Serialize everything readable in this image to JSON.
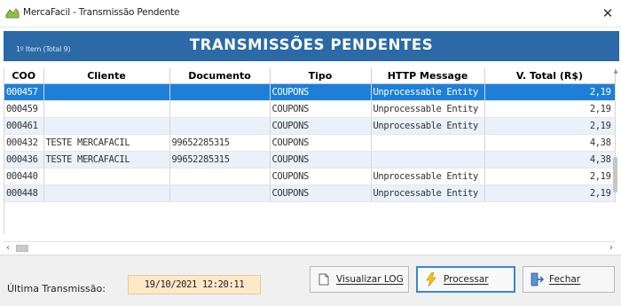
{
  "window": {
    "title": "MercaFacil - Transmissão Pendente",
    "close_glyph": "✕",
    "icon": "app-icon"
  },
  "banner": {
    "item_counter": "1º Item (Total 9)",
    "title": "TRANSMISSÕES PENDENTES",
    "background": "#2b6aa6"
  },
  "grid": {
    "columns": [
      "COO",
      "Cliente",
      "Documento",
      "Tipo",
      "HTTP Message",
      "V. Total (R$)"
    ],
    "rows": [
      {
        "coo": "000457",
        "cliente": "",
        "documento": "",
        "tipo": "COUPONS",
        "http": "Unprocessable Entity",
        "total": "2,19",
        "state": "selected"
      },
      {
        "coo": "000459",
        "cliente": "",
        "documento": "",
        "tipo": "COUPONS",
        "http": "Unprocessable Entity",
        "total": "2,19",
        "state": "normal"
      },
      {
        "coo": "000461",
        "cliente": "",
        "documento": "",
        "tipo": "COUPONS",
        "http": "Unprocessable Entity",
        "total": "2,19",
        "state": "alt"
      },
      {
        "coo": "000432",
        "cliente": "TESTE MERCAFACIL",
        "documento": "99652285315",
        "tipo": "COUPONS",
        "http": "",
        "total": "4,38",
        "state": "normal"
      },
      {
        "coo": "000436",
        "cliente": "TESTE MERCAFACIL",
        "documento": "99652285315",
        "tipo": "COUPONS",
        "http": "",
        "total": "4,38",
        "state": "alt"
      },
      {
        "coo": "000440",
        "cliente": "",
        "documento": "",
        "tipo": "COUPONS",
        "http": "Unprocessable Entity",
        "total": "2,19",
        "state": "normal"
      },
      {
        "coo": "000448",
        "cliente": "",
        "documento": "",
        "tipo": "COUPONS",
        "http": "Unprocessable Entity",
        "total": "2,19",
        "state": "alt"
      }
    ],
    "selected_color": "#1e7fd9",
    "alt_row_color": "#e9f1fb"
  },
  "footer": {
    "last_transmission_label": "Última Transmissão:",
    "last_transmission_value": "19/10/2021 12:20:11",
    "buttons": {
      "view_log": "Visualizar LOG",
      "process": "Processar",
      "close": "Fechar"
    },
    "icons": {
      "view_log": "document-icon",
      "process": "lightning-icon",
      "close": "exit-door-icon"
    }
  }
}
